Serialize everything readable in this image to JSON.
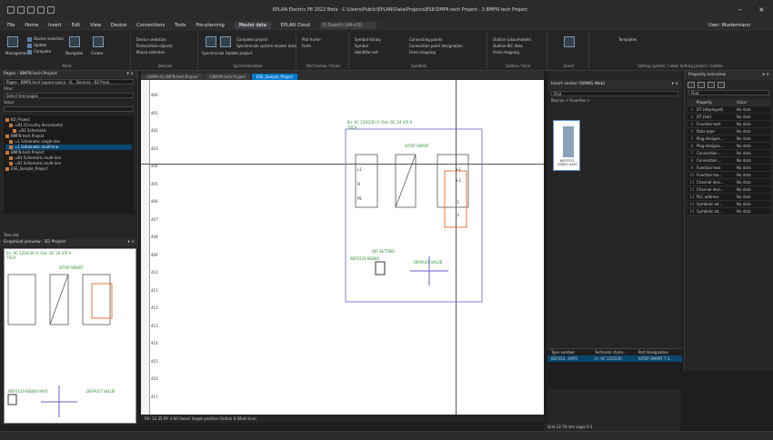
{
  "title": "EPLAN Electric P8 2022 Beta - C:\\Users\\Public\\EPLAN\\Data\\Projects\\ESE\\DMFA tech Project - 3.BMFN tech Project",
  "quick_access": [
    "new",
    "open",
    "save",
    "undo",
    "redo"
  ],
  "menu": {
    "items": [
      "File",
      "Home",
      "Insert",
      "Edit",
      "View",
      "Device",
      "Connections",
      "Tools",
      "Pre-planning",
      "Master data",
      "EPLAN Cloud"
    ],
    "active": "Master data",
    "search": "Q Search (Alt+Q)",
    "user": "User: Mustermann"
  },
  "ribbon": {
    "parts": {
      "label": "Parts",
      "management": "Management",
      "update": "Update",
      "complete": "Complete",
      "navigator": "Navigator",
      "create": "Create"
    },
    "devices": {
      "label": "Devices",
      "items": [
        "Device selection",
        "Parts/article objects",
        "Macro selection"
      ]
    },
    "sync": {
      "label": "Synchronization",
      "items": [
        "Complete project",
        "Synchronize system master data"
      ],
      "btn": "Synchronize Update project"
    },
    "plot": {
      "label": "Plot frames / forms",
      "items": [
        "Plot frame",
        "Form"
      ]
    },
    "symbols": {
      "label": "Symbols",
      "items": [
        "Symbol library",
        "Symbol",
        "Identifier set"
      ]
    },
    "conn": {
      "items": [
        "Connecting points",
        "Connection point designation",
        "Form mapping"
      ]
    },
    "outline": {
      "label": "Outline / form",
      "items": [
        "Outline (placeholder)",
        "Outline IEC data",
        "Form mapping"
      ]
    },
    "insert_label": "Insert",
    "templates": {
      "label": "Templates"
    },
    "setting": "Setting system / notes   Setting project / outline"
  },
  "pages": {
    "title": "Pages - BMFN tech Project",
    "breadcrumb": "Pages - BMFN tech  Layout space - B...  Devices - B2 Proje...",
    "filter_label": "Filter:",
    "filter_value": "Select tree pages",
    "value_label": "Value:",
    "tree": [
      "B2_Project",
      "=B1 (Circuitry documents)",
      "=B1 Schematic",
      "BMFN tech Project",
      "=1 Schematic single-line",
      "=1 Schematic multi-line",
      "BMFN tech Project",
      "=B1 Schematic multi-line",
      "=B1 Schematic multi-line",
      "ESE_Sample_Project"
    ],
    "selected": 5,
    "tabs": "Tree   List"
  },
  "graphic": {
    "title": "Graphical preview - B2 Project",
    "caption": "B+ AC 120/230 V; Out: DC 24 V/5 A",
    "sub": "TSCA",
    "smart": "SITOP SMART",
    "tag": "6EP3333-8SB00-0AY0",
    "sw": "SW1 SETTING",
    "dv": "DEFAULT VALUE"
  },
  "doc_tabs": [
    "<DMFA-4) 0MFN tech Project",
    "3-BMFN tech Project",
    "ESE_Sample_Project"
  ],
  "sheet": {
    "lines": [
      "400",
      "401",
      "402",
      "403",
      "404",
      "405",
      "406",
      "407",
      "408",
      "409",
      "410",
      "411",
      "412",
      "413",
      "414",
      "415",
      "416",
      "417"
    ],
    "box_caption": "B+ AC 120/230 V; Out: DC 24 V/5 A",
    "box_sub": "TSCA",
    "smart": "SITOP SMART",
    "order": "6EP3333-8SB00",
    "sw": "DIP SETTING",
    "dv": "DEFAULT VALUE",
    "pins_l": [
      "L1",
      "N",
      "PE"
    ],
    "pins_r": [
      "+1",
      "+2",
      "-1",
      "-2"
    ]
  },
  "status": "RX: 12.35   RY: 4.00   Select target position (Action 8 (Multi line)",
  "insert_center": {
    "title": "Insert center (SIMNS.Web)",
    "filter": "Find",
    "breadcrumb": "Macros  >  Favorites  >",
    "item": "6EP3333-8SB00-0AY0"
  },
  "parts_table": {
    "headers": [
      "Type number",
      "Technical chara...",
      "Part Designation"
    ],
    "row": [
      "6EP333...0AY0",
      "in: AC 120/230",
      "SITOP SMART 7.5..."
    ]
  },
  "props": {
    "title": "Property overview",
    "filter": "Find",
    "headers": [
      "Property",
      "Value"
    ],
    "rows": [
      [
        "DT (displayed)",
        "No data"
      ],
      [
        "DT (full)",
        "No data"
      ],
      [
        "Function text",
        "No data"
      ],
      [
        "Data type",
        "No data"
      ],
      [
        "Plug designa...",
        "No data"
      ],
      [
        "Plug designa...",
        "No data"
      ],
      [
        "Connection ...",
        "No data"
      ],
      [
        "Connection ...",
        "No data"
      ],
      [
        "Function text",
        "No data"
      ],
      [
        "Function tex...",
        "No data"
      ],
      [
        "Channel desi...",
        "No data"
      ],
      [
        "Channel desi...",
        "No data"
      ],
      [
        "PLC address",
        "No data"
      ],
      [
        "Symbolic ad...",
        "No data"
      ],
      [
        "Symbolic ad...",
        "No data"
      ]
    ]
  },
  "view_status": "Grid 12.70 mm   Logic 0:1",
  "colors": {
    "accent": "#007acc",
    "orange": "#e8743b",
    "purple": "#6a5acd",
    "green": "#2e8b2e"
  }
}
